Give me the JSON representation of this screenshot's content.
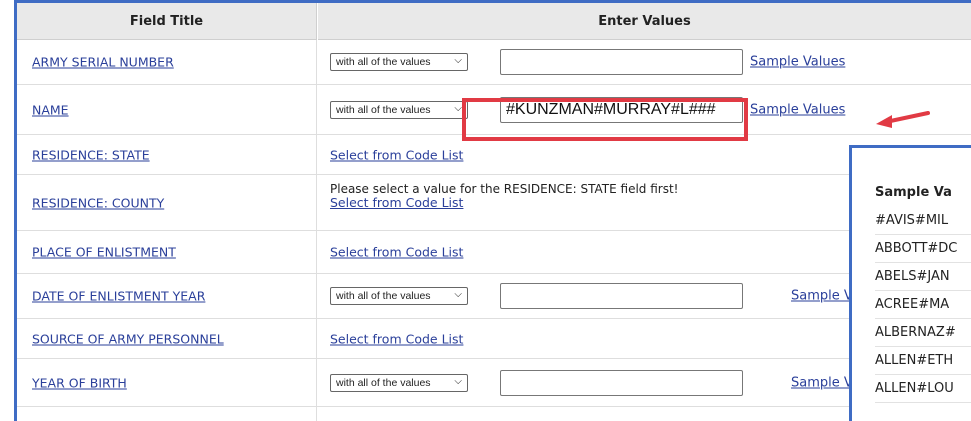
{
  "header": {
    "col1": "Field Title",
    "col2": "Enter Values"
  },
  "rows": [
    {
      "title": "ARMY SERIAL NUMBER",
      "select": "with all of the values",
      "value": "",
      "sample": "Sample Values"
    },
    {
      "title": "NAME",
      "select": "with all of the values",
      "value": "#KUNZMAN#MURRAY#L###",
      "sample": "Sample Values"
    },
    {
      "title": "RESIDENCE: STATE",
      "code_link": "Select from Code List"
    },
    {
      "title": "RESIDENCE: COUNTY",
      "message": "Please select a value for the RESIDENCE: STATE field first!",
      "code_link": "Select from Code List"
    },
    {
      "title": "PLACE OF ENLISTMENT",
      "code_link": "Select from Code List"
    },
    {
      "title": "DATE OF ENLISTMENT YEAR",
      "select": "with all of the values",
      "value": "",
      "sample": "Sample Value"
    },
    {
      "title": "SOURCE OF ARMY PERSONNEL",
      "code_link": "Select from Code List"
    },
    {
      "title": "YEAR OF BIRTH",
      "select": "with all of the values",
      "value": "",
      "sample": "Sample Value"
    }
  ],
  "sample_panel": {
    "title": "Sample Va",
    "items": [
      "#AVIS#MIL",
      "ABBOTT#DC",
      "ABELS#JAN",
      "ACREE#MA",
      "ALBERNAZ#",
      "ALLEN#ETH",
      "ALLEN#LOU"
    ]
  },
  "colors": {
    "highlight": "#e13a44",
    "frame": "#3f6cc4",
    "link": "#2a3f9a"
  },
  "icons": {
    "select_chevron": "chevron-down-icon",
    "annotation": "red-arrow-icon"
  }
}
